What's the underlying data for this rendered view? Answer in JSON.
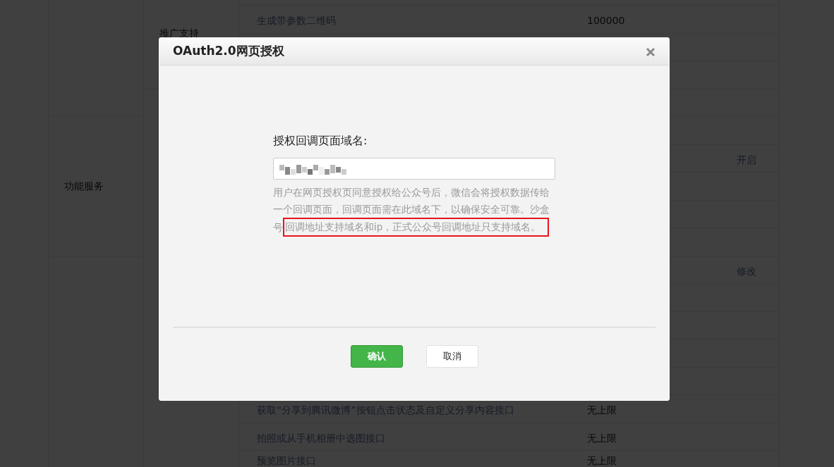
{
  "background_table": {
    "categories": [
      {
        "label": "功能服务"
      }
    ],
    "subgroups": [
      {
        "label": "推广支持"
      }
    ],
    "rows": [
      {
        "name": "生成带参数二维码",
        "limit": "100000"
      },
      {
        "action": "开启"
      },
      {
        "action": "修改"
      },
      {
        "name": "获取“分享到腾讯微博”按钮点击状态及自定义分享内容接口",
        "limit": "无上限"
      },
      {
        "name": "拍照或从手机相册中选图接口",
        "limit": "无上限"
      },
      {
        "name": "预览图片接口",
        "limit": "无上限"
      }
    ]
  },
  "dialog": {
    "title": "OAuth2.0网页授权",
    "field_label": "授权回调页面域名:",
    "field_redacted": true,
    "help": [
      {
        "text": "用户在网页授权页同意授权给公众号后，微信会将授权数据传给一个回调页面，回调页面需在此域名下，以确保安全可靠。沙盒",
        "highlighted": false
      },
      {
        "text": "号",
        "highlighted": false
      },
      {
        "text": "回调地址支持域名和ip，正式公众号回调地址只支持域名。",
        "highlighted": true
      }
    ],
    "buttons": [
      {
        "label": "确认",
        "kind": "primary"
      },
      {
        "label": "取消",
        "kind": "secondary"
      }
    ]
  }
}
